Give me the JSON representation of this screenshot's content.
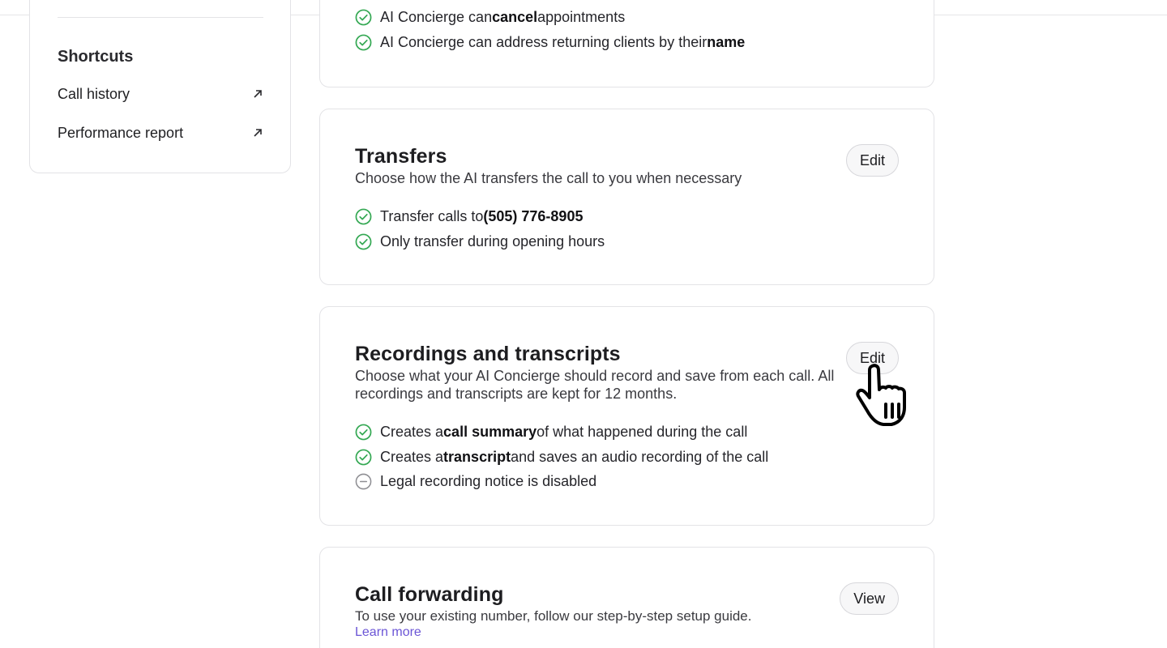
{
  "sidebar": {
    "title": "Shortcuts",
    "links": [
      {
        "label": "Call history",
        "icon": "external-link-icon"
      },
      {
        "label": "Performance report",
        "icon": "external-link-icon"
      }
    ]
  },
  "card_features_top": {
    "items": [
      {
        "pre": "AI Concierge can ",
        "bold": "cancel",
        "post": " appointments",
        "status": "enabled"
      },
      {
        "pre": "AI Concierge can address returning clients by their ",
        "bold": "name",
        "post": "",
        "status": "enabled"
      }
    ]
  },
  "transfers": {
    "title": "Transfers",
    "description": "Choose how the AI transfers the call to you when necessary",
    "button": "Edit",
    "items": [
      {
        "pre": "Transfer calls to ",
        "bold": "(505) 776-8905",
        "post": "",
        "status": "enabled"
      },
      {
        "pre": "Only transfer during opening hours",
        "bold": "",
        "post": "",
        "status": "enabled"
      }
    ]
  },
  "recordings": {
    "title": "Recordings and transcripts",
    "description_line1": "Choose what your AI Concierge should record and save from each call. All",
    "description_line2": "recordings and transcripts are kept for 12 months.",
    "button": "Edit",
    "items": [
      {
        "pre": "Creates a ",
        "bold": "call summary",
        "post": " of what happened during the call",
        "status": "enabled"
      },
      {
        "pre": "Creates a ",
        "bold": "transcript",
        "post": " and saves an audio recording of the call",
        "status": "enabled"
      },
      {
        "pre": "Legal recording notice is disabled",
        "bold": "",
        "post": "",
        "status": "disabled"
      }
    ]
  },
  "forwarding": {
    "title": "Call forwarding",
    "description": "To use your existing number, follow our step-by-step setup guide.",
    "link": "Learn more",
    "button": "View"
  },
  "colors": {
    "check_green": "#34a853",
    "disabled_gray": "#8e8e93",
    "link_purple": "#6b55d6"
  }
}
